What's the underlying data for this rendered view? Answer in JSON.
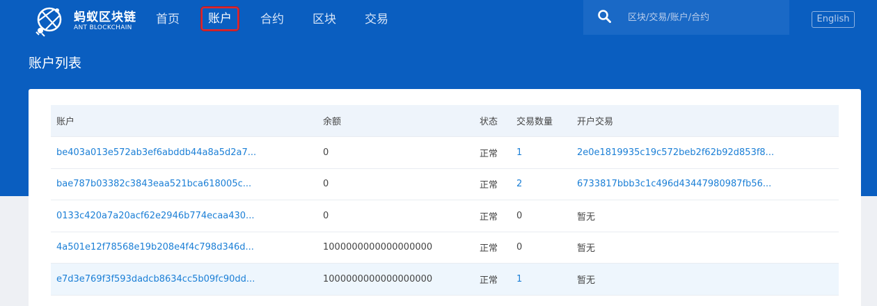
{
  "brand": {
    "name_cn": "蚂蚁区块链",
    "name_en": "ANT BLOCKCHAIN"
  },
  "nav": {
    "items": [
      {
        "label": "首页"
      },
      {
        "label": "账户"
      },
      {
        "label": "合约"
      },
      {
        "label": "区块"
      },
      {
        "label": "交易"
      }
    ],
    "active": "账户"
  },
  "search": {
    "placeholder": "区块/交易/账户/合约",
    "icon": "search-icon"
  },
  "lang_button": "English",
  "page_title": "账户列表",
  "colors": {
    "header_bg": "#0a5ec0",
    "link": "#1b7fd6",
    "active_outline": "#e0262e"
  },
  "table": {
    "headers": [
      "账户",
      "余额",
      "状态",
      "交易数量",
      "开户交易"
    ],
    "rows": [
      {
        "account": "be403a013e572ab3ef6abddb44a8a5d2a7...",
        "balance": "0",
        "status": "正常",
        "tx_count": "1",
        "open_tx": "2e0e1819935c19c572beb2f62b92d853f8..."
      },
      {
        "account": "bae787b03382c3843eaa521bca618005c...",
        "balance": "0",
        "status": "正常",
        "tx_count": "2",
        "open_tx": "6733817bbb3c1c496d43447980987fb56..."
      },
      {
        "account": "0133c420a7a20acf62e2946b774ecaa430...",
        "balance": "0",
        "status": "正常",
        "tx_count": "0",
        "open_tx": "暂无"
      },
      {
        "account": "4a501e12f78568e19b208e4f4c798d346d...",
        "balance": "1000000000000000000",
        "status": "正常",
        "tx_count": "0",
        "open_tx": "暂无"
      },
      {
        "account": "e7d3e769f3f593dadcb8634cc5b09fc90dd...",
        "balance": "1000000000000000000",
        "status": "正常",
        "tx_count": "1",
        "open_tx": "暂无"
      }
    ]
  }
}
